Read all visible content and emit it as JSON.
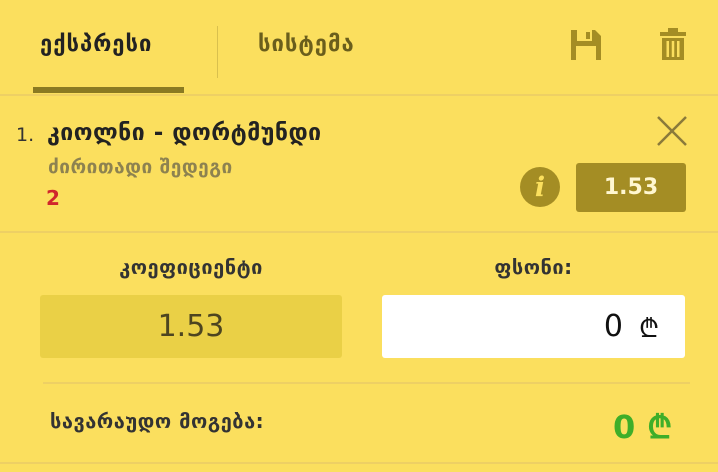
{
  "tabs": {
    "express": "ექსპრესი",
    "system": "სისტემა"
  },
  "icons": {
    "save": "floppy-disk-icon",
    "delete": "trash-icon",
    "close": "close-icon",
    "info": "info-icon"
  },
  "bet": {
    "index": "1.",
    "match": "კიოლნი - დორტმუნდი",
    "market": "ძირითადი შედეგი",
    "outcome": "2",
    "odd": "1.53",
    "info_symbol": "i"
  },
  "form": {
    "coefficient_label": "კოეფიციენტი",
    "coefficient_value": "1.53",
    "stake_label": "ფსონი:",
    "stake_value": "0",
    "currency": "₾"
  },
  "summary": {
    "winnings_label": "სავარაუდო მოგება:",
    "winnings_value": "0",
    "currency": "₾"
  },
  "colors": {
    "background": "#fbdf5e",
    "accent": "#a48d24",
    "outcome": "#d0262c",
    "winnings": "#3fae29"
  }
}
